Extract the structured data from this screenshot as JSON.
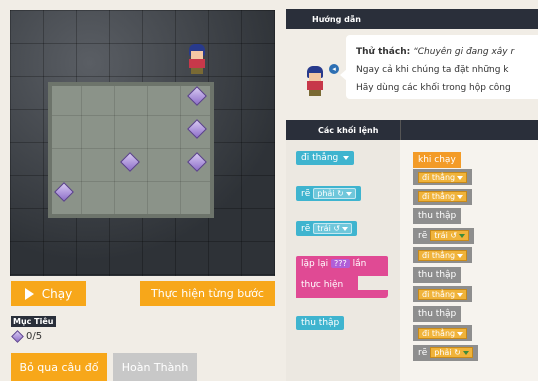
{
  "instructions": {
    "header": "Hướng dẫn",
    "challenge_label": "Thử thách:",
    "challenge_text": "“Chuyên gi đang xây r",
    "line2": "Ngay cả khi chúng ta đặt những k",
    "line3": "Hãy dùng các khối trong hộp công"
  },
  "game": {
    "run_label": "Chạy",
    "step_label": "Thực hiện từng bước",
    "goal_title": "Mục Tiêu",
    "goal_progress": "0/5",
    "skip_label": "Bỏ qua câu đố",
    "done_label": "Hoàn Thành"
  },
  "blocks_header": "Các khối lệnh",
  "toolbox": {
    "move_forward": "đi thẳng",
    "turn_right": "rẽ",
    "turn_right_dir": "phải ↻",
    "turn_left": "rẽ",
    "turn_left_dir": "trái ↺",
    "repeat_prefix": "lặp lại",
    "repeat_count": "???",
    "repeat_suffix": "lần",
    "repeat_do": "thực hiện",
    "collect": "thu thập"
  },
  "workspace": {
    "when_run": "khi chạy",
    "program": [
      {
        "text": "đi thẳng",
        "type": "drop"
      },
      {
        "text": "đi thẳng",
        "type": "drop"
      },
      {
        "text": "thu thập",
        "type": "plain"
      },
      {
        "text": "rẽ",
        "drop": "trái ↺",
        "type": "turn"
      },
      {
        "text": "đi thẳng",
        "type": "drop"
      },
      {
        "text": "thu thập",
        "type": "plain"
      },
      {
        "text": "đi thẳng",
        "type": "drop"
      },
      {
        "text": "thu thập",
        "type": "plain"
      },
      {
        "text": "đi thẳng",
        "type": "drop"
      },
      {
        "text": "rẽ",
        "drop": "phải ↻",
        "type": "turn"
      }
    ]
  },
  "colors": {
    "accent_orange": "#f7a71a",
    "block_cyan": "#3fb4cf",
    "block_pink": "#e04a94",
    "header_dark": "#2a2f3a"
  }
}
